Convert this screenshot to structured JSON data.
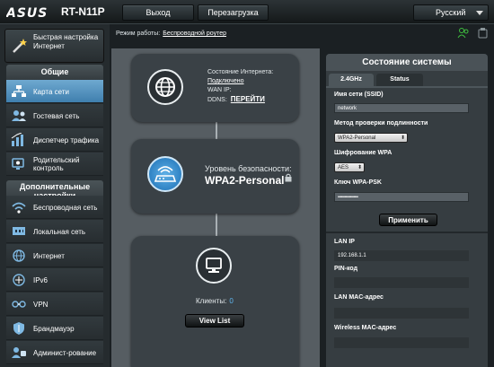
{
  "header": {
    "brand": "ASUS",
    "model": "RT-N11P",
    "logout_label": "Выход",
    "reboot_label": "Перезагрузка",
    "language": "Русский"
  },
  "sidebar": {
    "quick_setup_label": "Быстрая настройка Интернет",
    "general_title": "Общие",
    "general_items": [
      {
        "label": "Карта сети",
        "icon": "network-map-icon",
        "active": true
      },
      {
        "label": "Гостевая сеть",
        "icon": "guest-network-icon",
        "active": false
      },
      {
        "label": "Диспетчер трафика",
        "icon": "traffic-manager-icon",
        "active": false
      },
      {
        "label": "Родительский контроль",
        "icon": "parental-control-icon",
        "active": false
      }
    ],
    "advanced_title": "Дополнительные настройки",
    "advanced_items": [
      {
        "label": "Беспроводная сеть",
        "icon": "wireless-icon"
      },
      {
        "label": "Локальная сеть",
        "icon": "lan-icon"
      },
      {
        "label": "Интернет",
        "icon": "wan-globe-icon"
      },
      {
        "label": "IPv6",
        "icon": "ipv6-icon"
      },
      {
        "label": "VPN",
        "icon": "vpn-icon"
      },
      {
        "label": "Брандмауэр",
        "icon": "firewall-icon"
      },
      {
        "label": "Админист-рование",
        "icon": "administration-icon"
      }
    ]
  },
  "main": {
    "mode_label": "Режим работы:",
    "mode_value": "Беспроводной роутер"
  },
  "map": {
    "internet": {
      "status_label": "Состояние Интернета:",
      "status_value": "Подключено",
      "wan_ip_label": "WAN IP:",
      "ddns_label": "DDNS:",
      "ddns_link": "ПЕРЕЙТИ"
    },
    "security": {
      "label": "Уровень безопасности:",
      "value": "WPA2-Personal"
    },
    "clients": {
      "label": "Клиенты:",
      "count": "0",
      "view_list": "View List"
    }
  },
  "status_panel": {
    "title": "Состояние системы",
    "tabs": [
      "2.4GHz",
      "Status"
    ],
    "ssid_label": "Имя сети (SSID)",
    "ssid_value": "network",
    "auth_label": "Метод проверки подлинности",
    "auth_value": "WPA2-Personal",
    "enc_label": "Шифрование WPA",
    "enc_value": "AES",
    "psk_label": "Ключ WPA-PSK",
    "psk_value": "••••••••••••••••••",
    "apply_label": "Применить",
    "lan_ip_label": "LAN IP",
    "lan_ip_value": "192.168.1.1",
    "pin_label": "PIN-код",
    "pin_value": "",
    "lan_mac_label": "LAN MAC-адрес",
    "lan_mac_value": "",
    "wl_mac_label": "Wireless MAC-адрес",
    "wl_mac_value": ""
  },
  "colors": {
    "accent_blue": "#4a8fc3",
    "panel_dark": "#363d41",
    "map_bg": "#565d62"
  }
}
